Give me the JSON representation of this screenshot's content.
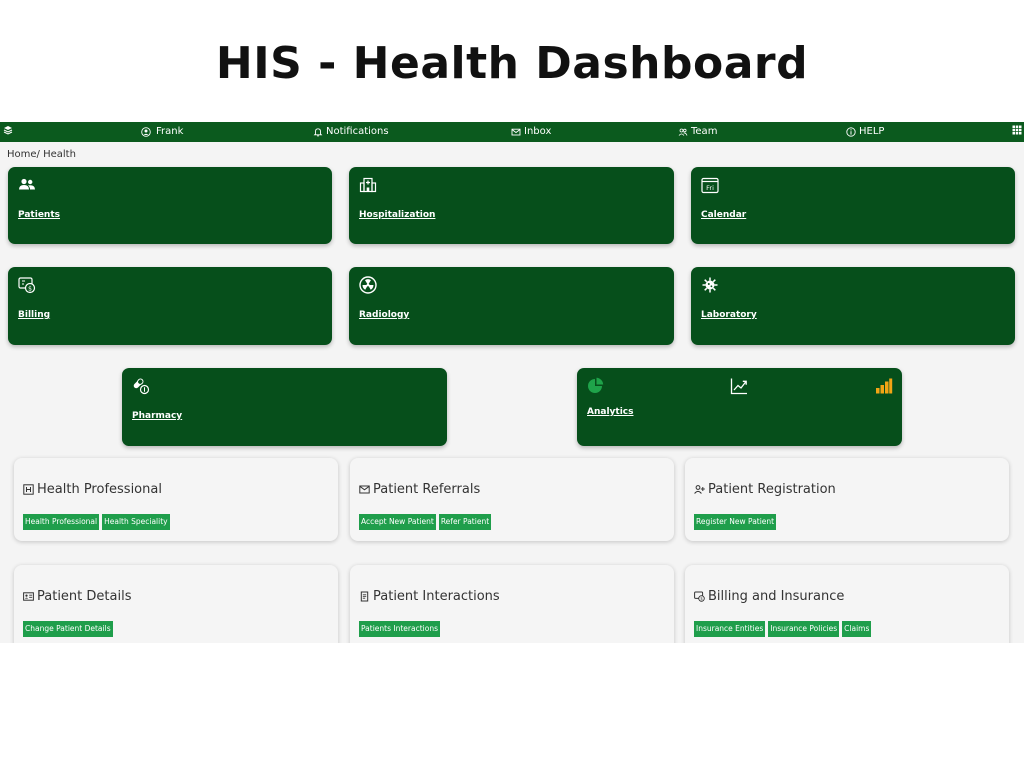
{
  "title": "HIS - Health Dashboard",
  "topbar": {
    "user": "Frank",
    "notifications": "Notifications",
    "inbox": "Inbox",
    "team": "Team",
    "help": "HELP",
    "icons": [
      "layers-icon",
      "user-icon",
      "bell-icon",
      "mail-icon",
      "team-icon",
      "info-icon",
      "grid-icon"
    ]
  },
  "breadcrumb": [
    "Home",
    "Health"
  ],
  "tiles": [
    {
      "label": "Patients",
      "icon": "users-icon"
    },
    {
      "label": "Hospitalization",
      "icon": "hospital-icon"
    },
    {
      "label": "Calendar",
      "icon": "calendar-icon",
      "icon_text": "Fri"
    },
    {
      "label": "Billing",
      "icon": "billing-icon"
    },
    {
      "label": "Radiology",
      "icon": "radiation-icon"
    },
    {
      "label": "Laboratory",
      "icon": "virus-icon"
    },
    {
      "label": "Pharmacy",
      "icon": "pills-icon"
    },
    {
      "label": "Analytics",
      "icons": [
        "pie-chart-icon",
        "line-chart-icon",
        "bar-chart-icon"
      ]
    }
  ],
  "cards": [
    {
      "title": "Health Professional",
      "icon": "h-square-icon",
      "buttons": [
        "Health Professional",
        "Health Speciality"
      ]
    },
    {
      "title": "Patient Referrals",
      "icon": "mail-icon",
      "buttons": [
        "Accept New Patient",
        "Refer Patient"
      ]
    },
    {
      "title": "Patient Registration",
      "icon": "user-plus-icon",
      "buttons": [
        "Register New Patient"
      ]
    },
    {
      "title": "Patient Details",
      "icon": "id-card-icon",
      "buttons": [
        "Change Patient Details"
      ]
    },
    {
      "title": "Patient Interactions",
      "icon": "document-icon",
      "buttons": [
        "Patients Interactions"
      ]
    },
    {
      "title": "Billing and Insurance",
      "icon": "billing-icon",
      "buttons": [
        "Insurance Entities",
        "Insurance Policies",
        "Claims"
      ]
    }
  ],
  "colors": {
    "topbar": "#0b5a1e",
    "tile": "#064f1b",
    "button": "#1f9e4b",
    "analytics_accent_green": "#1fa34a",
    "analytics_accent_orange": "#f2a515"
  }
}
